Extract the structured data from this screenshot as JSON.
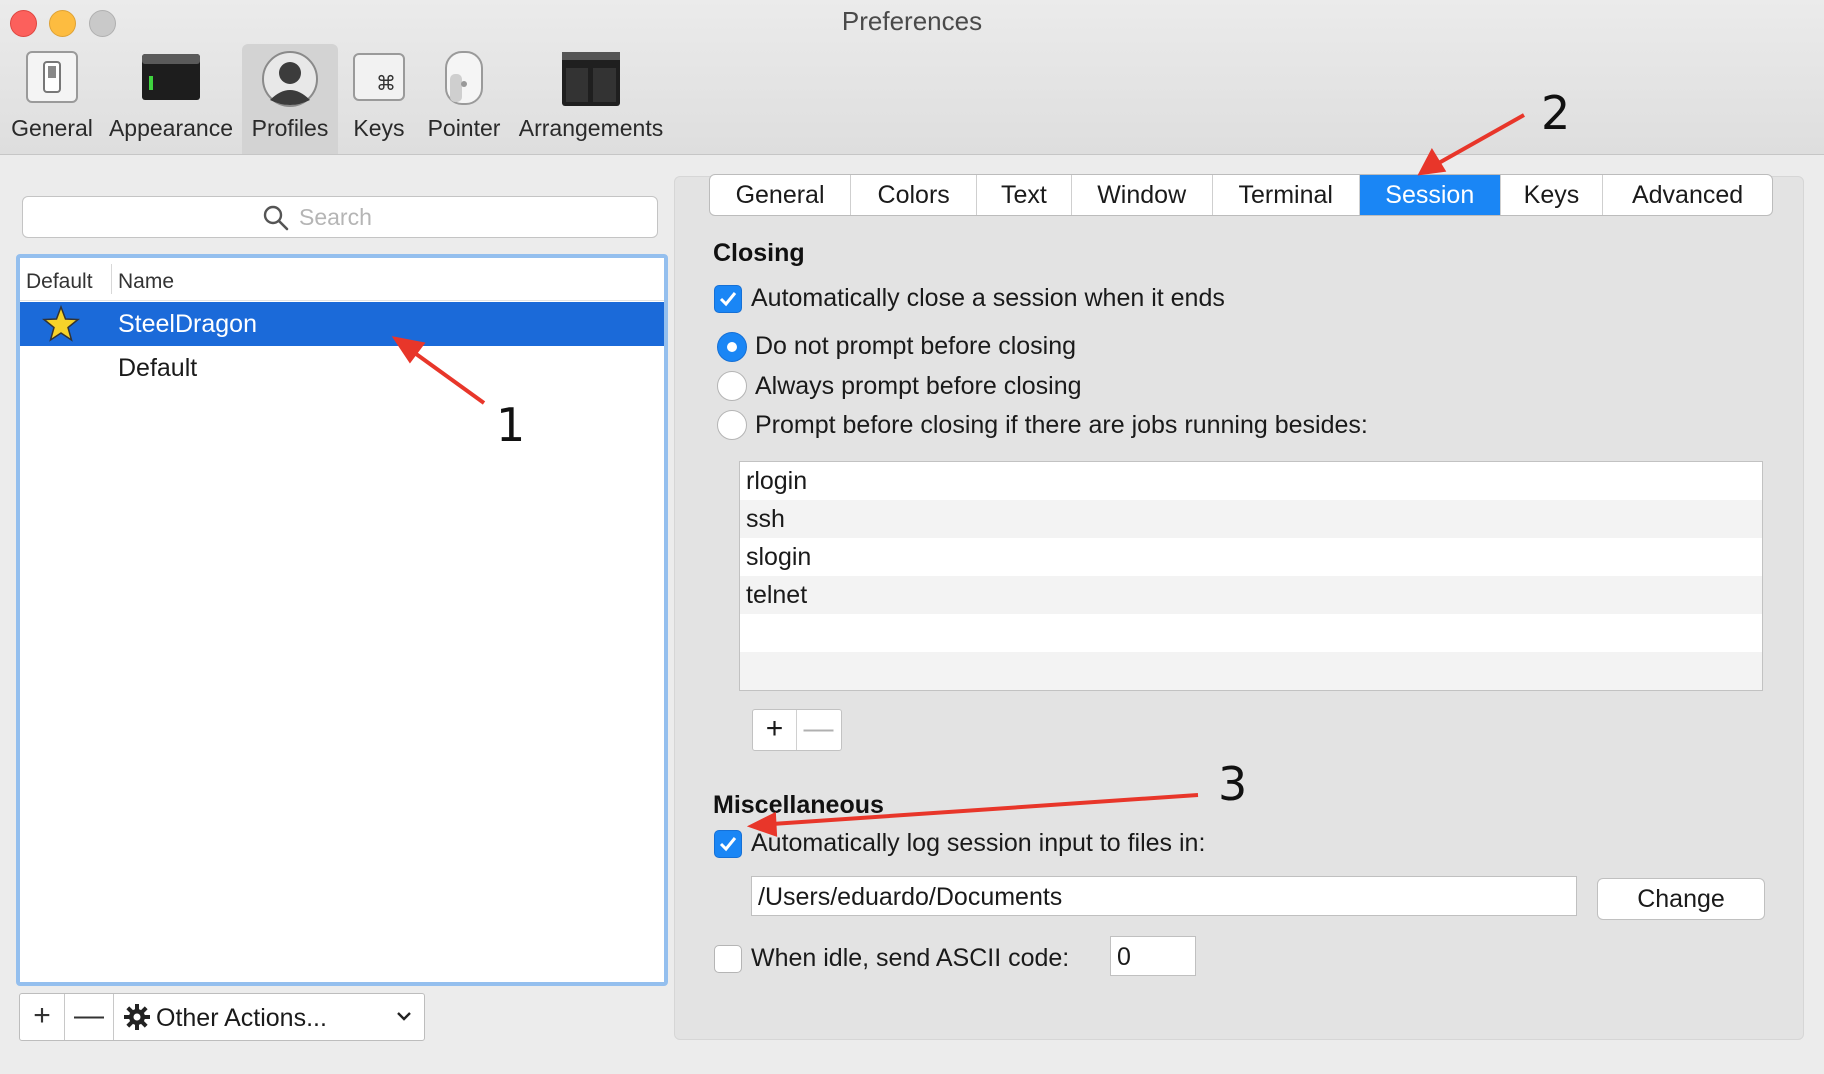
{
  "window": {
    "title": "Preferences"
  },
  "toolbar": {
    "items": [
      {
        "label": "General",
        "icon": "switch-icon"
      },
      {
        "label": "Appearance",
        "icon": "terminal-window-icon"
      },
      {
        "label": "Profiles",
        "icon": "user-silhouette-icon",
        "selected": true
      },
      {
        "label": "Keys",
        "icon": "command-key-icon"
      },
      {
        "label": "Pointer",
        "icon": "mouse-icon"
      },
      {
        "label": "Arrangements",
        "icon": "window-arrangement-icon"
      }
    ]
  },
  "profiles": {
    "search_placeholder": "Search",
    "columns": [
      "Default",
      "Name"
    ],
    "rows": [
      {
        "name": "SteelDragon",
        "is_default": true,
        "selected": true
      },
      {
        "name": "Default",
        "is_default": false,
        "selected": false
      }
    ],
    "add_label": "+",
    "remove_label": "—",
    "other_actions_label": "Other Actions..."
  },
  "settings": {
    "tabs": [
      "General",
      "Colors",
      "Text",
      "Window",
      "Terminal",
      "Session",
      "Keys",
      "Advanced"
    ],
    "active_tab": "Session",
    "closing": {
      "heading": "Closing",
      "auto_close_label": "Automatically close a session when it ends",
      "auto_close_checked": true,
      "radio_options": [
        "Do not prompt before closing",
        "Always prompt before closing",
        "Prompt before closing if there are jobs running besides:"
      ],
      "radio_selected": 0,
      "jobs": [
        "rlogin",
        "ssh",
        "slogin",
        "telnet"
      ],
      "add_label": "+",
      "remove_label": "—"
    },
    "misc": {
      "heading": "Miscellaneous",
      "log_label": "Automatically log session input to files in:",
      "log_checked": true,
      "log_path": "/Users/eduardo/Documents",
      "change_label": "Change",
      "idle_label": "When idle, send ASCII code:",
      "idle_checked": false,
      "idle_value": "0"
    }
  },
  "annotations": {
    "n1": "1",
    "n2": "2",
    "n3": "3",
    "arrow_color": "#e8362a"
  },
  "colors": {
    "accent": "#1a86f5",
    "selection": "#1b6ad9"
  }
}
